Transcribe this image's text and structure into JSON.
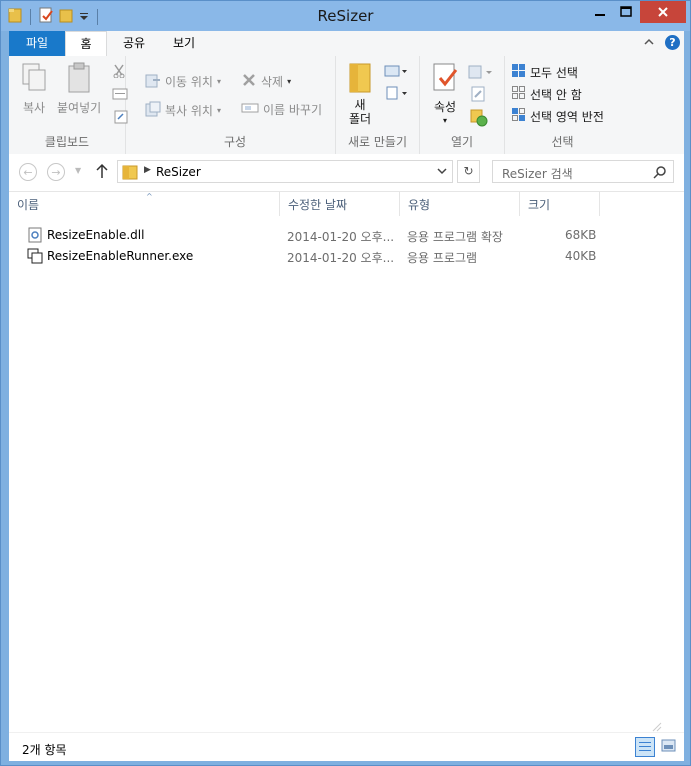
{
  "window": {
    "title": "ReSizer",
    "minimize_label": "—",
    "maximize_label": "☐",
    "close_label": "✕"
  },
  "tabs": {
    "file": "파일",
    "home": "홈",
    "share": "공유",
    "view": "보기"
  },
  "ribbon": {
    "clipboard": {
      "copy": "복사",
      "paste": "붙여넣기",
      "label": "클립보드"
    },
    "organize": {
      "move_to": "이동 위치",
      "copy_to": "복사 위치",
      "delete": "삭제",
      "rename": "이름 바꾸기",
      "label": "구성"
    },
    "new": {
      "new_folder": "새\n폴더",
      "label": "새로 만들기"
    },
    "open": {
      "properties": "속성",
      "label": "열기"
    },
    "select": {
      "select_all": "모두 선택",
      "select_none": "선택 안 함",
      "invert": "선택 영역 반전",
      "label": "선택"
    }
  },
  "nav": {
    "path": "ReSizer",
    "search_placeholder": "ReSizer 검색"
  },
  "columns": {
    "name": "이름",
    "date": "수정한 날짜",
    "type": "유형",
    "size": "크기"
  },
  "files": [
    {
      "name": "ResizeEnable.dll",
      "date": "2014-01-20 오후...",
      "type": "응용 프로그램 확장",
      "size": "68KB"
    },
    {
      "name": "ResizeEnableRunner.exe",
      "date": "2014-01-20 오후...",
      "type": "응용 프로그램",
      "size": "40KB"
    }
  ],
  "status": {
    "count": "2개 항목"
  }
}
